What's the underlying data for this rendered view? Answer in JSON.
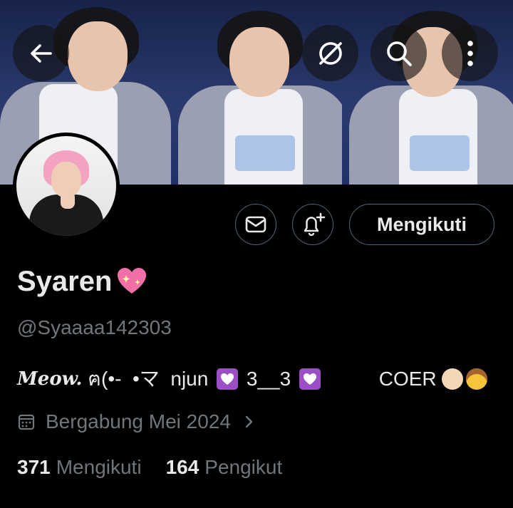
{
  "header": {
    "back_icon": "arrow-left-icon",
    "grok_icon": "slashed-circle-icon",
    "search_icon": "search-icon",
    "more_icon": "more-vertical-icon"
  },
  "profile": {
    "display_name": "Syaren",
    "name_emoji": "💖",
    "handle": "@Syaaaa142303",
    "bio": {
      "meow": "Meow.",
      "part1": " ฅ(•-  •マ  njun ",
      "part2": " 3__3 ",
      "part3": "          COER "
    },
    "joined": "Bergabung Mei 2024",
    "following_count": "371",
    "following_label": "Mengikuti",
    "followers_count": "164",
    "followers_label": "Pengikut"
  },
  "actions": {
    "message_icon": "envelope-icon",
    "notify_icon": "bell-plus-icon",
    "follow_label": "Mengikuti"
  },
  "colors": {
    "background": "#000000",
    "text": "#e7e9ea",
    "muted": "#71767b",
    "border": "#536471"
  }
}
